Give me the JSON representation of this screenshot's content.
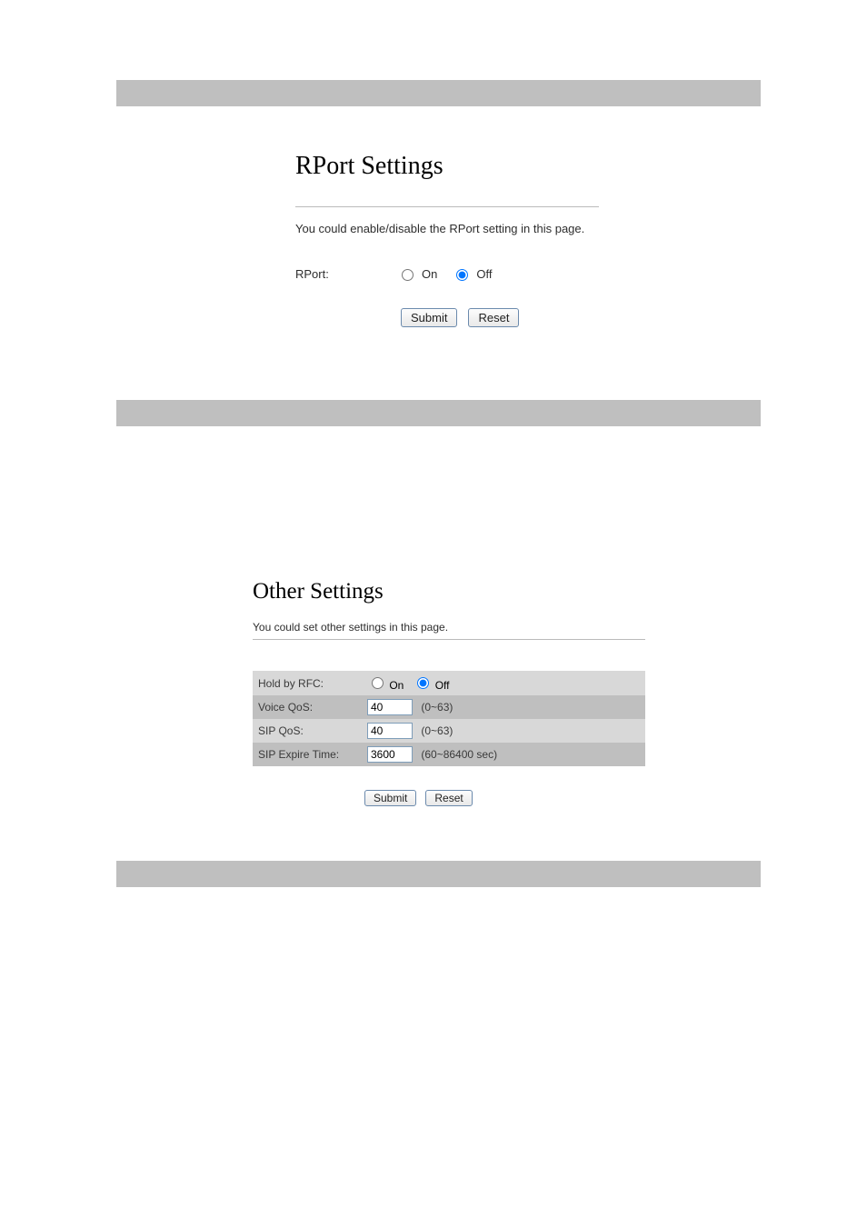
{
  "rport": {
    "title": "RPort Settings",
    "description": "You could enable/disable the RPort setting in this page.",
    "label": "RPort:",
    "options": {
      "on": "On",
      "off": "Off"
    },
    "selected": "off",
    "buttons": {
      "submit": "Submit",
      "reset": "Reset"
    }
  },
  "other": {
    "title": "Other Settings",
    "description": "You could set other settings in this page.",
    "rows": {
      "hold_by_rfc": {
        "label": "Hold by RFC:",
        "options": {
          "on": "On",
          "off": "Off"
        },
        "selected": "off"
      },
      "voice_qos": {
        "label": "Voice QoS:",
        "value": "40",
        "hint": "(0~63)"
      },
      "sip_qos": {
        "label": "SIP QoS:",
        "value": "40",
        "hint": "(0~63)"
      },
      "sip_expire_time": {
        "label": "SIP Expire Time:",
        "value": "3600",
        "hint": "(60~86400 sec)"
      }
    },
    "buttons": {
      "submit": "Submit",
      "reset": "Reset"
    }
  }
}
